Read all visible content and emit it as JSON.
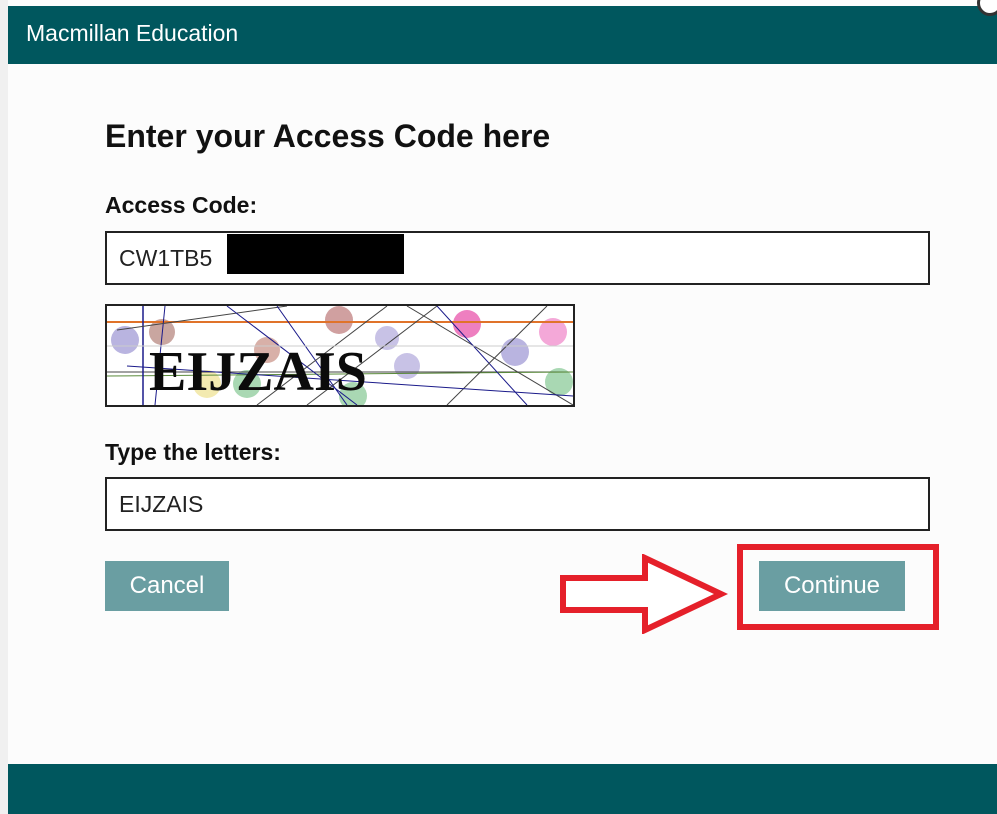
{
  "header": {
    "title": "Macmillan Education"
  },
  "form": {
    "heading": "Enter your Access Code here",
    "access_code_label": "Access Code:",
    "access_code_value": "CW1TB5",
    "captcha_text": "EIJZAIS",
    "type_letters_label": "Type the letters:",
    "type_letters_value": "EIJZAIS"
  },
  "buttons": {
    "cancel_label": "Cancel",
    "continue_label": "Continue"
  },
  "colors": {
    "header_bg": "#00575e",
    "button_bg": "#6a9ea2",
    "highlight": "#e5202a"
  }
}
